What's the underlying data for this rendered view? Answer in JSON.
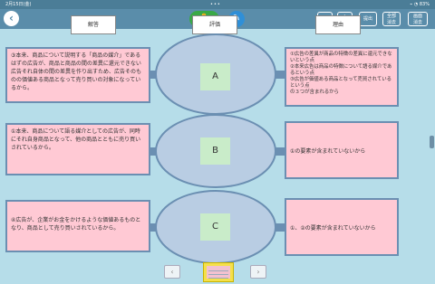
{
  "status_bar": {
    "time": "9:41",
    "date": "2月15日(金)",
    "dots": "•••",
    "signal": "⌁ ◔ 83%"
  },
  "toolbar": {
    "back_icon": "‹",
    "hand_icon": "✋",
    "pen_icon": "✎",
    "panel_icon": "▤",
    "share_icon": "⇪",
    "submit_label": "提出",
    "erase_all_label": "全部\n消去",
    "screen_erase_label": "画面\n消去"
  },
  "headers": {
    "solution": "解答",
    "evaluation": "評価",
    "reason": "理由"
  },
  "rows": [
    {
      "left_text": "③本来、商品について説明する「商品の媒介」であるはずの広告が、商品と商品の間の差異に還元できない広告それ自体の間の差異を作り出すため、広告そのものの価値ある商品となって売り買いの対象になっているから。",
      "grade": "A",
      "right_text": "①広告の差異が商品の特徴の差異に還元できないという点\n②本来広告は商品の特徴について語る媒介であるという点\n③広告が価値ある商品となって売買されているという点\nの３つが含まれるから"
    },
    {
      "left_text": "①本来、商品について語る媒介としての広告が、同時にそれ自身商品となって、他の商品とともに売り買いされているから。",
      "grade": "B",
      "right_text": "①の要素が含まれていないから"
    },
    {
      "left_text": "④広告が、企業がお金をかけるような価値あるものとなり、商品として売り買いされているから。",
      "grade": "C",
      "right_text": "①、②の要素が含まれていないから"
    }
  ],
  "footer": {
    "prev_icon": "‹",
    "next_icon": "›"
  },
  "colors": {
    "background": "#b6dde9",
    "toolbar": "#5a8daa",
    "box_fill": "#ffc9d4",
    "box_border": "#6b8fb2",
    "grade_fill": "#c9ecc9",
    "hand_button": "#39a947",
    "pen_button": "#2f8fd7"
  }
}
